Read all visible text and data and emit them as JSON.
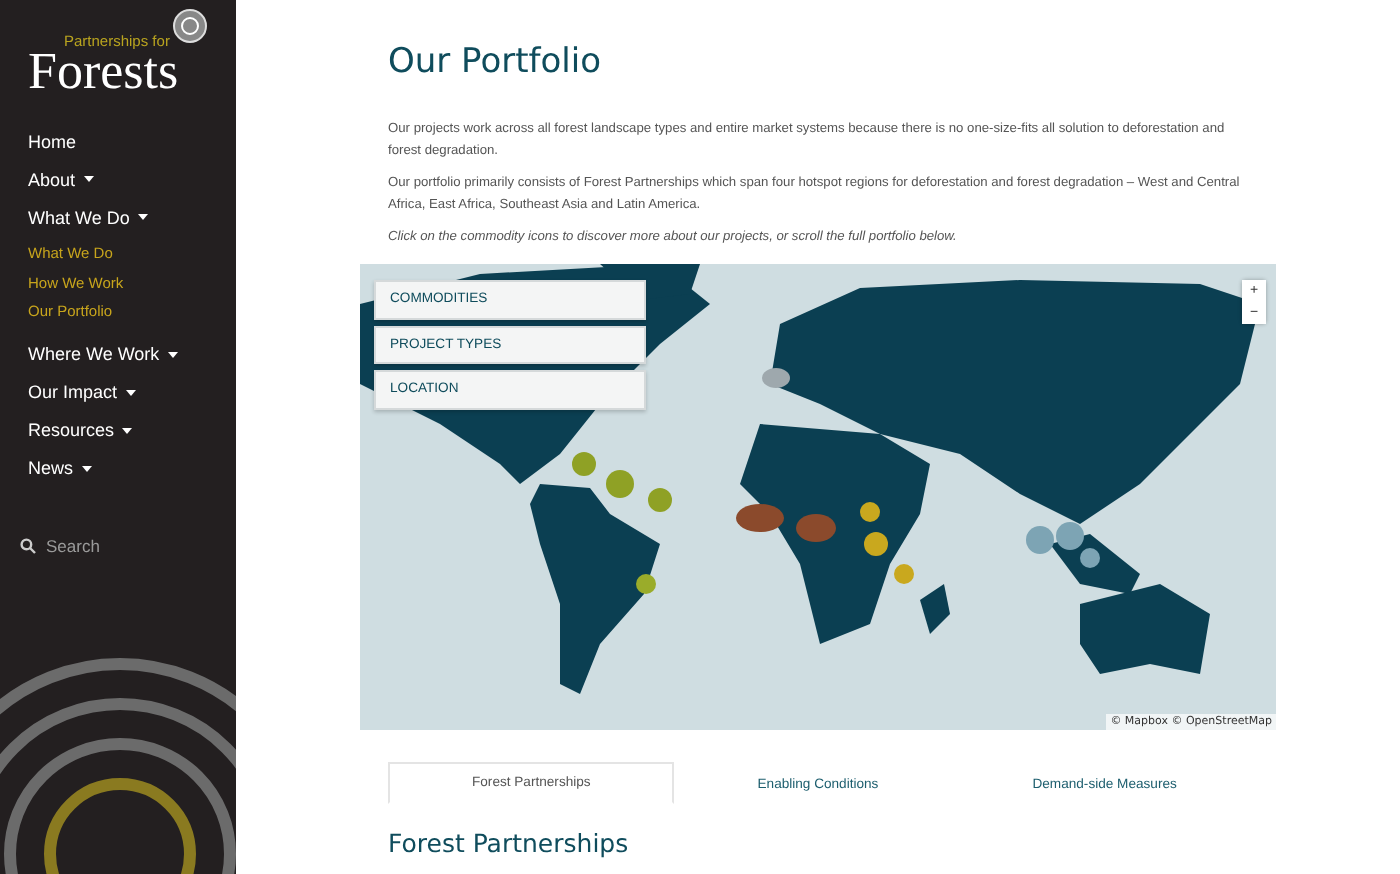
{
  "logo": {
    "tagline": "Partnerships for",
    "name": "Forests"
  },
  "nav": [
    {
      "label": "Home",
      "has_menu": false
    },
    {
      "label": "About",
      "has_menu": true
    },
    {
      "label": "What We Do",
      "has_menu": true,
      "children": [
        {
          "label": "What We Do"
        },
        {
          "label": "How We Work"
        },
        {
          "label": "Our Portfolio"
        }
      ]
    },
    {
      "label": "Where We Work",
      "has_menu": true
    },
    {
      "label": "Our Impact",
      "has_menu": true
    },
    {
      "label": "Resources",
      "has_menu": true
    },
    {
      "label": "News",
      "has_menu": true
    }
  ],
  "search": {
    "placeholder": "Search"
  },
  "page": {
    "title": "Our Portfolio",
    "paragraphs": [
      "Our projects work across all forest landscape types and entire market systems because there is no one-size-fits all solution to deforestation and forest degradation.",
      "Our portfolio primarily consists of Forest Partnerships which span four hotspot regions for deforestation and forest degradation – West and Central Africa, East Africa, Southeast Asia and Latin America."
    ],
    "note": "Click on the commodity icons to discover more about our projects, or scroll the full portfolio below."
  },
  "map": {
    "filters": [
      "COMMODITIES",
      "PROJECT TYPES",
      "LOCATION"
    ],
    "zoom": [
      "+",
      "−"
    ],
    "attribution": "© Mapbox © OpenStreetMap"
  },
  "tabs": [
    {
      "label": "Forest Partnerships",
      "selected": true
    },
    {
      "label": "Enabling Conditions",
      "selected": false
    },
    {
      "label": "Demand-side Measures",
      "selected": false
    }
  ],
  "section_title": "Forest Partnerships"
}
